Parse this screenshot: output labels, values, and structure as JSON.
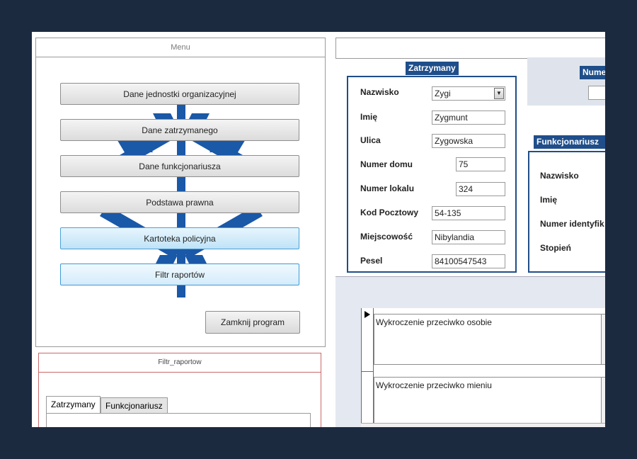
{
  "menu": {
    "title": "Menu",
    "buttons": [
      "Dane jednostki organizacyjnej",
      "Dane zatrzymanego",
      "Dane funkcjonariusza",
      "Podstawa prawna",
      "Kartoteka policyjna",
      "Filtr raportów"
    ],
    "close_label": "Zamknij program"
  },
  "filter_form": {
    "title": "Filtr_raportow",
    "tabs": [
      "Zatrzymany",
      "Funkcjonariusz"
    ]
  },
  "zatrzymany": {
    "title": "Zatrzymany",
    "fields": [
      {
        "label": "Nazwisko",
        "value": "Zygi"
      },
      {
        "label": "Imię",
        "value": "Zygmunt"
      },
      {
        "label": "Ulica",
        "value": "Zygowska"
      },
      {
        "label": "Numer domu",
        "value": "75"
      },
      {
        "label": "Numer lokalu",
        "value": "324"
      },
      {
        "label": "Kod Pocztowy",
        "value": "54-135"
      },
      {
        "label": "Miejscowość",
        "value": "Nibylandia"
      },
      {
        "label": "Pesel",
        "value": "84100547543"
      }
    ]
  },
  "numer_header": "Numer",
  "funkcjonariusz": {
    "title": "Funkcjonariusz pr",
    "fields": [
      "Nazwisko",
      "Imię",
      "Numer identyfik",
      "Stopień"
    ]
  },
  "offences": [
    "Wykroczenie przeciwko osobie",
    "Wykroczenie przeciwko mieniu"
  ],
  "colors": {
    "accent": "#1f4e8a",
    "background": "#1c2a40",
    "highlight": "#bfe3f7"
  }
}
